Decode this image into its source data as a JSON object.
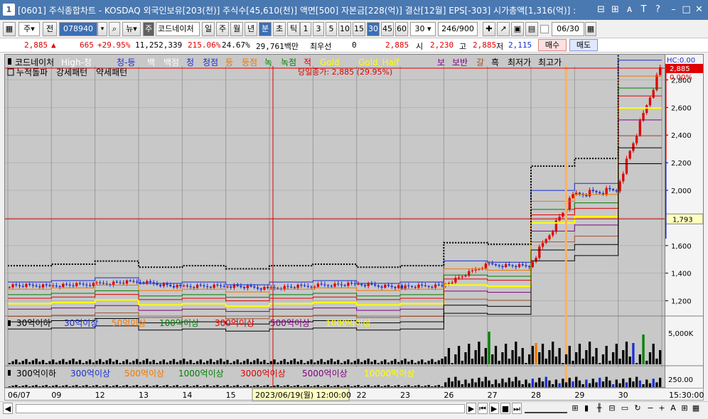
{
  "titlebar": {
    "num": "1",
    "title": "[0601] 주식종합차트 - KOSDAQ 외국인보유[203(천)] 주식수[45,610(천)] 액면[500] 자본금[228(억)] 결산[12월] EPS[-303] 시가총액[1,316(억)] :",
    "icons": [
      "window-icon",
      "link-icon",
      "font-icon",
      "text-icon",
      "help-icon",
      "minimize-icon",
      "maximize-icon",
      "close-icon"
    ],
    "icon_glyphs": [
      "⊟",
      "⊞",
      "ᴀ",
      "T",
      "?",
      "–",
      "□",
      "✕"
    ]
  },
  "toolbar": {
    "market": "주",
    "prev_label": "전",
    "code": "078940",
    "news_label": "뉴",
    "stock_badge": "주",
    "stock_name": "코드네이처",
    "periods": [
      "일",
      "주",
      "월",
      "년",
      "분",
      "초",
      "틱"
    ],
    "selected_period": "분",
    "intervals": [
      "1",
      "3",
      "5",
      "10",
      "15",
      "30",
      "45",
      "60"
    ],
    "selected_interval": "30",
    "interval_value": "30",
    "count": "246",
    "count_total": "/900",
    "date": "06/30"
  },
  "quote": {
    "price": "2,885",
    "arrow": "▲",
    "change": "665",
    "change_pct": "+29.95%",
    "volume": "11,252,339",
    "volume_ratio": "215.06%",
    "turnover": "24.67%",
    "amount": "29,761백만",
    "quote_label": "최우선",
    "quote_value": "0",
    "ask_price": "2,885",
    "open_label": "시",
    "open": "2,230",
    "high_label": "고",
    "high": "2,885",
    "low_label": "저",
    "low": "2,115",
    "buy_label": "매수",
    "sell_label": "매도"
  },
  "legend": {
    "items": [
      {
        "text": "코드네이처",
        "color": "#000000"
      },
      {
        "text": "High-청",
        "color": "#ffffff"
      },
      {
        "text": "청-등",
        "color": "#1a2fd0"
      },
      {
        "text": "백",
        "color": "#ffffff"
      },
      {
        "text": "백점",
        "color": "#ffffff"
      },
      {
        "text": "청",
        "color": "#1a2fd0"
      },
      {
        "text": "청점",
        "color": "#1a2fd0"
      },
      {
        "text": "등",
        "color": "#f07800"
      },
      {
        "text": "등점",
        "color": "#f07800"
      },
      {
        "text": "녹",
        "color": "#008000"
      },
      {
        "text": "녹점",
        "color": "#008000"
      },
      {
        "text": "적",
        "color": "#e00000"
      },
      {
        "text": "Gold",
        "color": "#ffff00"
      },
      {
        "text": "Gold_Half",
        "color": "#ffff00"
      },
      {
        "text": "보",
        "color": "#800080"
      },
      {
        "text": "보반",
        "color": "#800080"
      },
      {
        "text": "갈",
        "color": "#a0522d"
      },
      {
        "text": "흑",
        "color": "#000000"
      },
      {
        "text": "최저가",
        "color": "#000000"
      },
      {
        "text": "최고가",
        "color": "#000000"
      }
    ],
    "pattern_items": [
      "누적돌파",
      "강세패턴",
      "약세패턴"
    ],
    "close_annotation": "당일종가: 2,885 (29.95%)"
  },
  "vol_legend": [
    {
      "text": "30억이하",
      "color": "#000000"
    },
    {
      "text": "30억이상",
      "color": "#1a2fd0"
    },
    {
      "text": "50억이상",
      "color": "#f07800"
    },
    {
      "text": "100억이상",
      "color": "#008000"
    },
    {
      "text": "300억이상",
      "color": "#e00000"
    },
    {
      "text": "500억이상",
      "color": "#800080"
    },
    {
      "text": "1000억이상",
      "color": "#ffff00"
    }
  ],
  "amt_legend": [
    {
      "text": "300억이하",
      "color": "#000000"
    },
    {
      "text": "300억이상",
      "color": "#1a2fd0"
    },
    {
      "text": "500억이상",
      "color": "#f07800"
    },
    {
      "text": "1000억이상",
      "color": "#008000"
    },
    {
      "text": "3000억이상",
      "color": "#e00000"
    },
    {
      "text": "5000억이상",
      "color": "#800080"
    },
    {
      "text": "10000억이상",
      "color": "#ffff00"
    }
  ],
  "axis": {
    "hc_label": "HC:0.00",
    "current_price": "2,885",
    "current_pct": "0.00%",
    "crosshair_price": "1,793",
    "vol_tick": "5,000K",
    "amt_tick": "250.00",
    "price_ticks": [
      "2,800",
      "2,600",
      "2,400",
      "2,200",
      "2,000",
      "1,800",
      "1,600",
      "1,400",
      "1,200"
    ]
  },
  "dates": {
    "labels": [
      "06/07",
      "09",
      "12",
      "13",
      "14",
      "15",
      "16",
      "21",
      "22",
      "23",
      "26",
      "27",
      "28",
      "29",
      "30"
    ],
    "crosshair_label": "2023/06/19(월) 12:00:00",
    "time": "15:30:00"
  },
  "chart_data": {
    "type": "candlestick",
    "symbol": "코드네이처",
    "interval": "30분",
    "y_range": [
      1100,
      2900
    ],
    "y_ticks": [
      1200,
      1400,
      1600,
      1800,
      2000,
      2200,
      2400,
      2600,
      2800
    ],
    "days": [
      "06/07",
      "09",
      "12",
      "13",
      "14",
      "15",
      "16",
      "21",
      "22",
      "23",
      "26",
      "27",
      "28",
      "29",
      "30"
    ],
    "daily_close_estimate": [
      1310,
      1320,
      1340,
      1300,
      1310,
      1290,
      1310,
      1320,
      1300,
      1310,
      1460,
      1450,
      1960,
      2010,
      2885
    ],
    "last_close": 2885,
    "last_change_pct": 29.95,
    "crosshair_price": 1793,
    "volume_max_label": "5,000K",
    "amount_tick_label": "250.00"
  }
}
